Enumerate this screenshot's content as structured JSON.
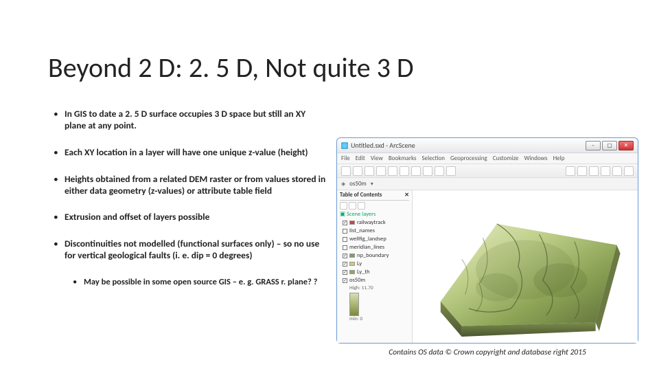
{
  "slide": {
    "title": "Beyond 2 D: 2. 5 D, Not quite 3 D",
    "bullets": [
      "In GIS to date a 2. 5 D surface occupies 3 D space but still an XY plane at any point.",
      "Each XY location in a layer will have one unique z-value (height)",
      "Heights obtained from a related DEM raster or from values stored in either data geometry (z-values) or attribute table field",
      "Extrusion and offset of layers possible",
      "Discontinuities not modelled (functional surfaces only) – so no use for vertical geological faults (i. e. dip = 0 degrees)"
    ],
    "sub_bullet": "May be possible in some open source GIS – e. g. GRASS r. plane? ?",
    "caption": "Contains OS data © Crown copyright and database right 2015"
  },
  "app": {
    "window_title": "Untitled.sxd - ArcScene",
    "menus": [
      "File",
      "Edit",
      "View",
      "Bookmarks",
      "Selection",
      "Geoprocessing",
      "Customize",
      "Windows",
      "Help"
    ],
    "toolbar2_label": "os50m",
    "toc": {
      "header": "Table of Contents",
      "scene_layers": "Scene layers",
      "items": [
        {
          "label": "railwaytrack",
          "checked": true,
          "color": "#cc4444"
        },
        {
          "label": "list_names",
          "checked": false,
          "color": "#dddddd"
        },
        {
          "label": "wellfig_landsep",
          "checked": false,
          "color": "#dddddd"
        },
        {
          "label": "meridian_lines",
          "checked": false,
          "color": "#dddddd"
        },
        {
          "label": "np_boundary",
          "checked": true,
          "color": "#7aa06a"
        },
        {
          "label": "Ly",
          "checked": true,
          "color": "#cccc77"
        },
        {
          "label": "Ly_th",
          "checked": true,
          "color": "#88aa66"
        }
      ],
      "raster": {
        "label": "os50m",
        "checked": true,
        "high": "11.70",
        "low": "min: 0"
      }
    }
  },
  "colors": {
    "terrain_light": "#d8e4b0",
    "terrain_mid": "#9eb26a",
    "terrain_dark": "#5f7038",
    "terrain_shadow": "#3f4a26"
  }
}
